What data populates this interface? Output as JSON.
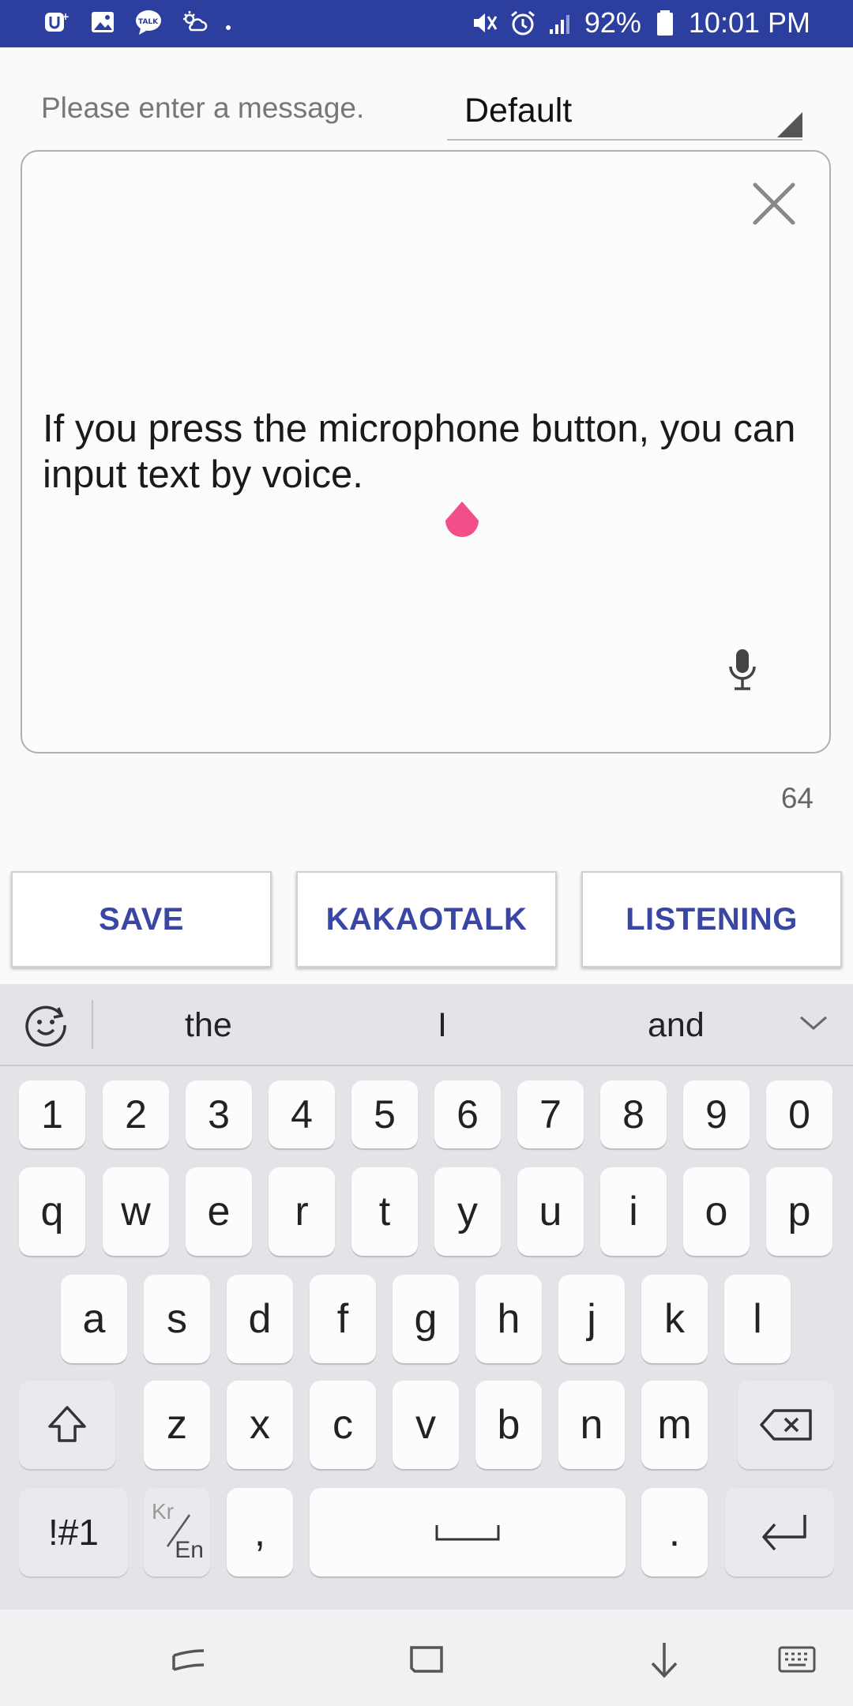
{
  "status_bar": {
    "battery": "92%",
    "time": "10:01 PM",
    "icons_left": [
      "u-plus-icon",
      "gallery-icon",
      "talk-icon",
      "weather-icon",
      "dot"
    ],
    "icons_right": [
      "mute-icon",
      "alarm-icon",
      "signal-icon",
      "battery-icon"
    ],
    "talk_label": "TALK"
  },
  "header": {
    "prompt": "Please enter a message.",
    "dropdown_value": "Default"
  },
  "editor": {
    "message": "If you press the microphone button, you can input text by voice.",
    "char_count": "64"
  },
  "actions": {
    "save": "SAVE",
    "kakaotalk": "KAKAOTALK",
    "listening": "LISTENING"
  },
  "keyboard": {
    "suggestions": [
      "the",
      "I",
      "and"
    ],
    "row_numbers": [
      "1",
      "2",
      "3",
      "4",
      "5",
      "6",
      "7",
      "8",
      "9",
      "0"
    ],
    "row_1": [
      "q",
      "w",
      "e",
      "r",
      "t",
      "y",
      "u",
      "i",
      "o",
      "p"
    ],
    "row_2": [
      "a",
      "s",
      "d",
      "f",
      "g",
      "h",
      "j",
      "k",
      "l"
    ],
    "row_3": [
      "z",
      "x",
      "c",
      "v",
      "b",
      "n",
      "m"
    ],
    "symbols": "!#1",
    "lang_top": "Kr",
    "lang_bottom": "En",
    "comma": ",",
    "period": "."
  },
  "colors": {
    "status_bar": "#2c3e9e",
    "accent": "#3a46a4",
    "cursor_handle": "#f24e8a"
  }
}
